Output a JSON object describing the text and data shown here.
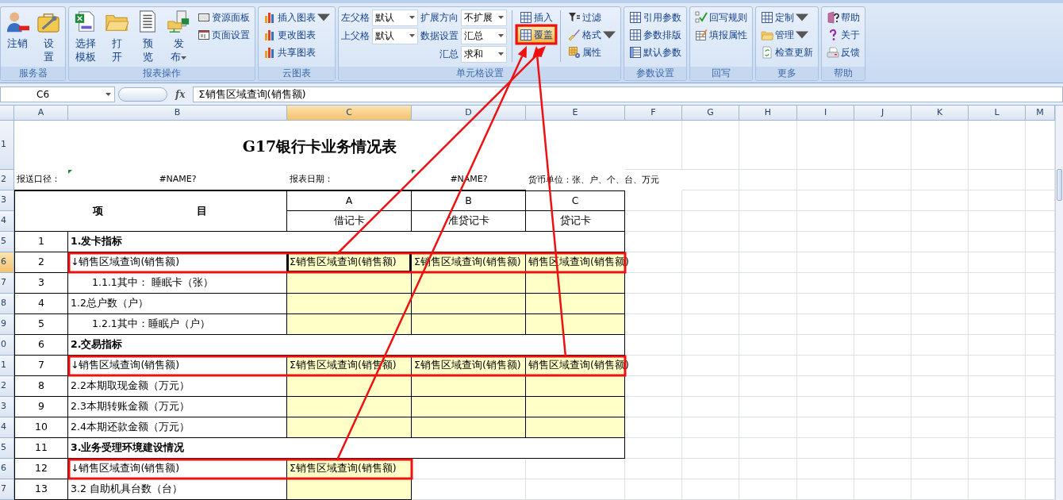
{
  "ribbon": {
    "groups": [
      {
        "label": "服务器",
        "columns": [
          {
            "items": [
              {
                "kind": "large",
                "lines": [
                  "注销"
                ]
              }
            ]
          },
          {
            "items": [
              {
                "kind": "large",
                "lines": [
                  "设",
                  "置"
                ]
              }
            ]
          }
        ]
      },
      {
        "label": "报表操作",
        "columns": [
          {
            "items": [
              {
                "kind": "large",
                "lines": [
                  "选择",
                  "模板"
                ]
              }
            ]
          },
          {
            "items": [
              {
                "kind": "large",
                "lines": [
                  "打",
                  "开"
                ]
              }
            ]
          },
          {
            "items": [
              {
                "kind": "large",
                "lines": [
                  "预",
                  "览"
                ]
              }
            ]
          },
          {
            "items": [
              {
                "kind": "large",
                "lines": [
                  "发",
                  "布"
                ],
                "dropdown": true
              }
            ]
          },
          {
            "items": [
              {
                "kind": "small",
                "label": "资源面板"
              },
              {
                "kind": "small",
                "label": "页面设置"
              }
            ]
          }
        ]
      },
      {
        "label": "云图表",
        "columns": [
          {
            "items": [
              {
                "kind": "small",
                "label": "插入图表",
                "dropdown": true
              },
              {
                "kind": "small",
                "label": "更改图表"
              },
              {
                "kind": "small",
                "label": "共享图表"
              }
            ]
          }
        ]
      },
      {
        "label": "单元格设置",
        "columns": [
          {
            "items": [
              {
                "kind": "select",
                "label": "左父格",
                "value": "默认"
              },
              {
                "kind": "select",
                "label": "上父格",
                "value": "默认"
              }
            ]
          },
          {
            "items": [
              {
                "kind": "select",
                "label": "扩展方向",
                "value": "不扩展"
              },
              {
                "kind": "select",
                "label": "数据设置",
                "value": "汇总"
              },
              {
                "kind": "select",
                "label": "汇总",
                "value": "求和"
              }
            ]
          },
          {
            "separated": true,
            "items": [
              {
                "kind": "small",
                "label": "插入"
              },
              {
                "kind": "small",
                "label": "覆盖",
                "highlighted": true,
                "boxed": true
              }
            ]
          },
          {
            "separated": true,
            "items": [
              {
                "kind": "small",
                "label": "过滤"
              },
              {
                "kind": "small",
                "label": "格式",
                "dropdown": true
              },
              {
                "kind": "small",
                "label": "属性"
              }
            ]
          }
        ]
      },
      {
        "label": "参数设置",
        "columns": [
          {
            "items": [
              {
                "kind": "small",
                "label": "引用参数"
              },
              {
                "kind": "small",
                "label": "参数排版"
              },
              {
                "kind": "small",
                "label": "默认参数"
              }
            ]
          }
        ]
      },
      {
        "label": "回写",
        "columns": [
          {
            "items": [
              {
                "kind": "small",
                "label": "回写规则"
              },
              {
                "kind": "small",
                "label": "填报属性"
              }
            ]
          }
        ]
      },
      {
        "label": "更多",
        "columns": [
          {
            "items": [
              {
                "kind": "small",
                "label": "定制",
                "dropdown": true
              },
              {
                "kind": "small",
                "label": "管理",
                "dropdown": true
              },
              {
                "kind": "small",
                "label": "检查更新"
              }
            ]
          }
        ]
      },
      {
        "label": "帮助",
        "columns": [
          {
            "items": [
              {
                "kind": "small",
                "label": "帮助"
              },
              {
                "kind": "small",
                "label": "关于"
              },
              {
                "kind": "small",
                "label": "反馈"
              }
            ]
          }
        ]
      }
    ]
  },
  "formula_bar": {
    "cell": "C6",
    "function_label": "fx",
    "formula": "Σ销售区域查询(销售额)"
  },
  "sheet": {
    "columns": [
      {
        "label": "A",
        "selected": false
      },
      {
        "label": "B",
        "selected": false
      },
      {
        "label": "C",
        "selected": true
      },
      {
        "label": "D",
        "selected": false
      },
      {
        "label": "E",
        "selected": false
      },
      {
        "label": "F",
        "selected": false
      },
      {
        "label": "G",
        "selected": false
      },
      {
        "label": "H",
        "selected": false
      },
      {
        "label": "I",
        "selected": false
      },
      {
        "label": "J",
        "selected": false
      },
      {
        "label": "K",
        "selected": false
      },
      {
        "label": "L",
        "selected": false
      },
      {
        "label": "M",
        "selected": false
      }
    ],
    "rows": [
      {
        "header": "1",
        "selected": false,
        "kind": "title",
        "title": "G17银行卡业务情况表"
      },
      {
        "header": "2",
        "selected": false,
        "kind": "info",
        "cells": [
          {
            "text": "报送口径："
          },
          {
            "text": "#NAME?",
            "flagged": true
          },
          {
            "text": "报表日期："
          },
          {
            "text": "#NAME?",
            "flagged": true
          },
          {
            "text": "货币单位：张、户、个、台、万元"
          }
        ]
      },
      {
        "header": "3",
        "selected": false,
        "kind": "colhead",
        "item": "项目",
        "codes": [
          "A",
          "B",
          "C"
        ]
      },
      {
        "header": "4",
        "selected": false,
        "kind": "colnames",
        "names": [
          "借记卡",
          "准贷记卡",
          "贷记卡"
        ]
      },
      {
        "header": "5",
        "selected": false,
        "kind": "section",
        "number": "1",
        "text": "1.发卡指标"
      },
      {
        "header": "6",
        "selected": true,
        "kind": "item",
        "number": "2",
        "label": "↓销售区域查询(销售额)",
        "boxed": true,
        "values": [
          {
            "text": "Σ销售区域查询(销售额)",
            "active": true,
            "arrow": true
          },
          {
            "text": "Σ销售区域查询(销售额)"
          },
          {
            "text": "销售区域查询(销售额)"
          }
        ]
      },
      {
        "header": "7",
        "selected": false,
        "kind": "subitem",
        "number": "3",
        "label": "1.1.1其中： 睡眠卡（张）"
      },
      {
        "header": "8",
        "selected": false,
        "kind": "item",
        "number": "4",
        "label": "1.2总户数（户）"
      },
      {
        "header": "9",
        "selected": false,
        "kind": "subitem",
        "number": "5",
        "label": "1.2.1其中：睡眠户（户）"
      },
      {
        "header": "0",
        "selected": false,
        "kind": "section",
        "number": "6",
        "text": "2.交易指标"
      },
      {
        "header": "1",
        "selected": false,
        "kind": "item",
        "number": "7",
        "label": "↓销售区域查询(销售额)",
        "boxed": true,
        "values": [
          {
            "text": "Σ销售区域查询(销售额)"
          },
          {
            "text": "Σ销售区域查询(销售额)"
          },
          {
            "text": "销售区域查询(销售额)",
            "arrow": true
          }
        ]
      },
      {
        "header": "2",
        "selected": false,
        "kind": "item",
        "number": "8",
        "label": "2.2本期取现金额（万元）"
      },
      {
        "header": "3",
        "selected": false,
        "kind": "item",
        "number": "9",
        "label": "2.3本期转账金额（万元）"
      },
      {
        "header": "4",
        "selected": false,
        "kind": "item",
        "number": "10",
        "label": "2.4本期还款金额（万元）"
      },
      {
        "header": "5",
        "selected": false,
        "kind": "section",
        "number": "11",
        "text": "3.业务受理环境建设情况"
      },
      {
        "header": "6",
        "selected": false,
        "kind": "tail_item",
        "number": "12",
        "label": "↓销售区域查询(销售额)",
        "boxed": true,
        "values": [
          {
            "text": "Σ销售区域查询(销售额)",
            "arrow": true
          }
        ]
      },
      {
        "header": "7",
        "selected": false,
        "kind": "tail_item",
        "number": "13",
        "label": "3.2 自助机具台数（台）"
      }
    ]
  }
}
